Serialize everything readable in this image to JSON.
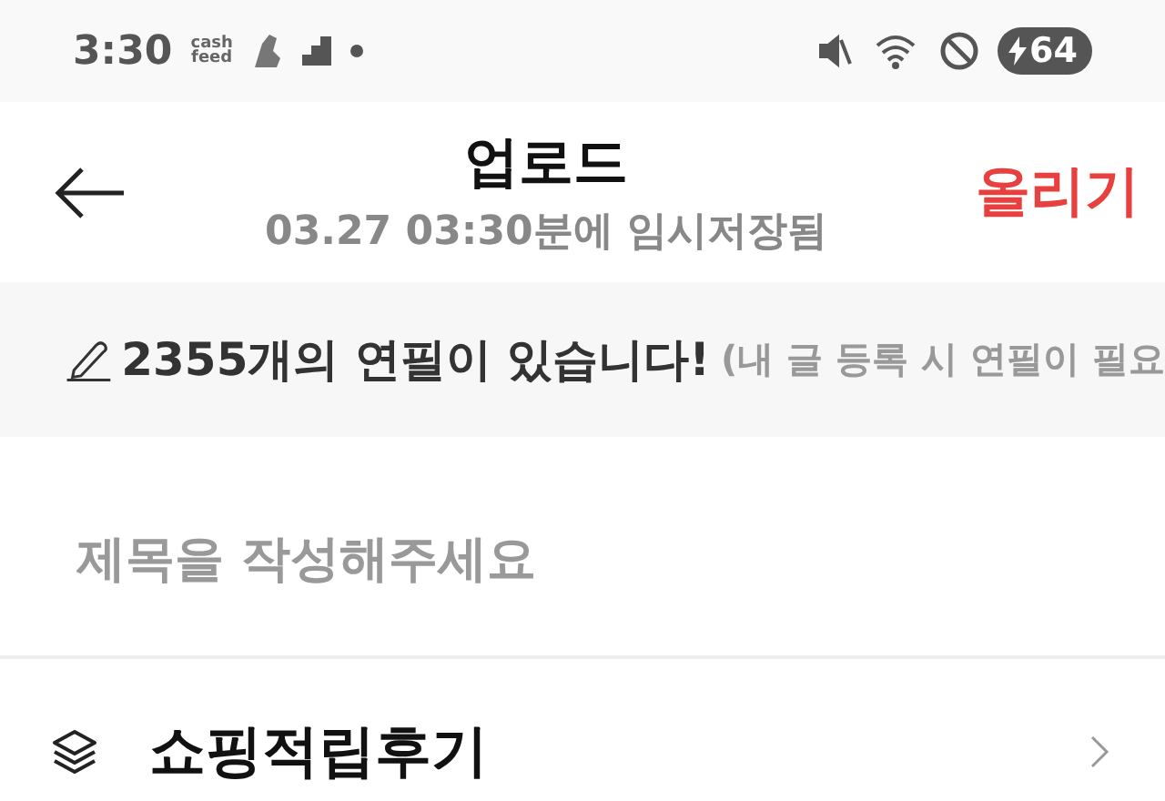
{
  "status_bar": {
    "time": "3:30",
    "app_logo": "cash\nfeed",
    "battery": "64"
  },
  "header": {
    "title": "업로드",
    "subtitle": "03.27 03:30분에 임시저장됨",
    "action": "올리기"
  },
  "banner": {
    "message": "2355개의 연필이 있습니다!",
    "note": "(내 글 등록 시 연필이 필요"
  },
  "title_field": {
    "placeholder": "제목을 작성해주세요"
  },
  "category": {
    "label": "쇼핑적립후기"
  }
}
